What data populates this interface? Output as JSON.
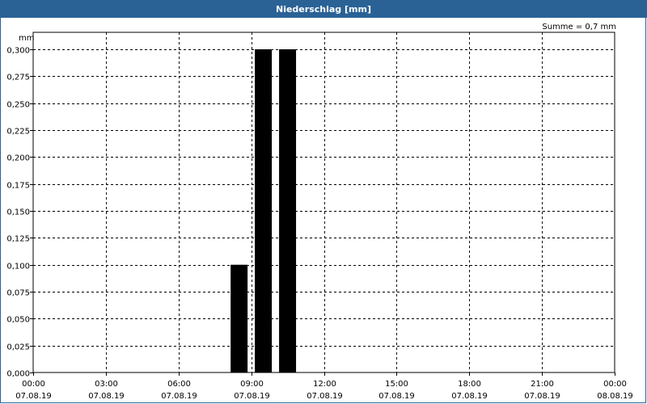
{
  "window": {
    "title": "Niederschlag [mm]"
  },
  "chart_data": {
    "type": "bar",
    "title": "Niederschlag [mm]",
    "ylabel": "mm",
    "annotation": "Summe = 0,7 mm",
    "ylim": [
      0,
      0.3
    ],
    "y_ticks": [
      "0,000",
      "0,025",
      "0,050",
      "0,075",
      "0,100",
      "0,125",
      "0,150",
      "0,175",
      "0,200",
      "0,225",
      "0,250",
      "0,275",
      "0,300"
    ],
    "x_range_hours": [
      0,
      24
    ],
    "x_ticks": [
      {
        "time": "00:00",
        "date": "07.08.19"
      },
      {
        "time": "03:00",
        "date": "07.08.19"
      },
      {
        "time": "06:00",
        "date": "07.08.19"
      },
      {
        "time": "09:00",
        "date": "07.08.19"
      },
      {
        "time": "12:00",
        "date": "07.08.19"
      },
      {
        "time": "15:00",
        "date": "07.08.19"
      },
      {
        "time": "18:00",
        "date": "07.08.19"
      },
      {
        "time": "21:00",
        "date": "07.08.19"
      },
      {
        "time": "00:00",
        "date": "08.08.19"
      }
    ],
    "series": [
      {
        "points": [
          {
            "start": "08:00",
            "end": "09:00",
            "value": 0.1
          },
          {
            "start": "09:00",
            "end": "10:00",
            "value": 0.3
          },
          {
            "start": "10:00",
            "end": "11:00",
            "value": 0.3
          }
        ]
      }
    ],
    "grid": true,
    "bar_color": "#000000"
  }
}
